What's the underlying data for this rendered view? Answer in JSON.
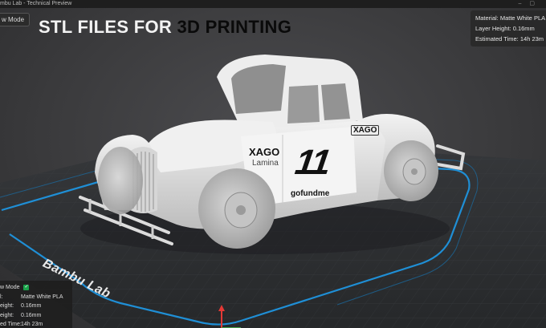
{
  "window": {
    "title": "mbu Lab - Technical Preview"
  },
  "toolbar": {
    "view_mode_label": "w Mode"
  },
  "headline": {
    "part1": "STL FILES FOR ",
    "part2": "3D PRINTING"
  },
  "info_top_right": {
    "material": "Material: Matte White PLA",
    "layer_height": "Layer Height: 0.16mm",
    "estimated_time": "Estimated Time: 14h 23m"
  },
  "info_bottom_left": {
    "title": "w Mode",
    "rows": [
      {
        "label": "l:",
        "value": "Matte White PLA"
      },
      {
        "label": "eight:",
        "value": "0.16mm"
      },
      {
        "label": "eight:",
        "value": "0.16mm"
      },
      {
        "label": "ed Time:",
        "value": "14h 23m"
      }
    ]
  },
  "bed": {
    "brand": "Bambu Lab"
  },
  "car": {
    "hood_sponsor": "XAGO",
    "hood_sponsor_sub": "Lamina",
    "number": "11",
    "door_sponsor": "gofundme",
    "rear_sponsor": "XAGO"
  },
  "colors": {
    "bed_border": "#1f8fd6",
    "bed_surface": "#2f3134",
    "model": "#e6e6e6",
    "check": "#1aa34a"
  },
  "icons": [
    "checkmark-icon",
    "axis-gizmo-icon"
  ]
}
